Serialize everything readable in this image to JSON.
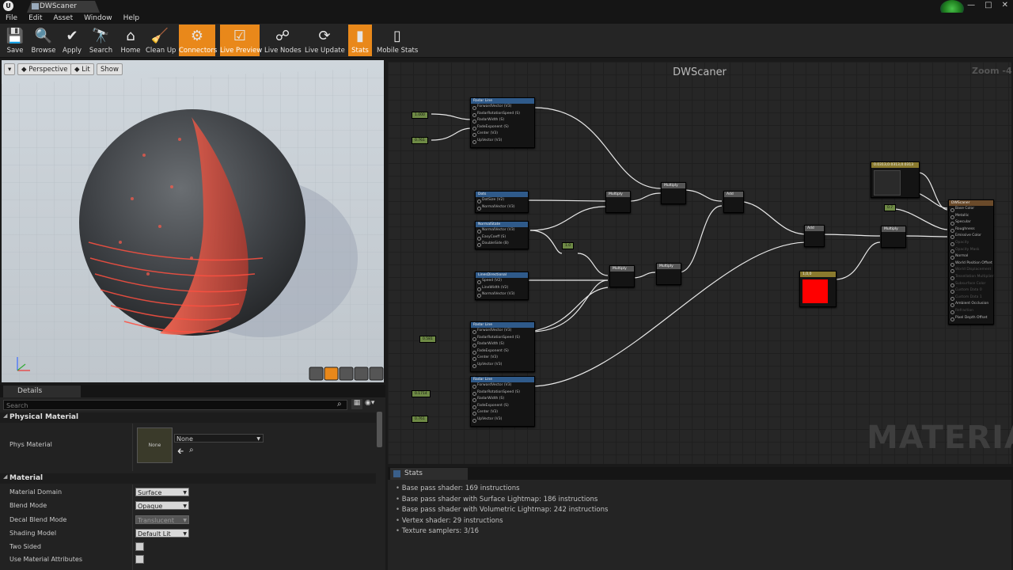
{
  "window": {
    "tab_title": "DWScaner",
    "controls": [
      "—",
      "□",
      "✕"
    ]
  },
  "menu": [
    "File",
    "Edit",
    "Asset",
    "Window",
    "Help"
  ],
  "toolbar": [
    {
      "label": "Save",
      "icon": "save-icon",
      "glyph": "💾",
      "active": false
    },
    {
      "label": "Browse",
      "icon": "browse-icon",
      "glyph": "🔍",
      "active": false
    },
    {
      "label": "Apply",
      "icon": "apply-icon",
      "glyph": "✔",
      "active": false
    },
    {
      "label": "Search",
      "icon": "search-icon",
      "glyph": "🔭",
      "active": false
    },
    {
      "label": "Home",
      "icon": "home-icon",
      "glyph": "⌂",
      "active": false
    },
    {
      "label": "Clean Up",
      "icon": "cleanup-icon",
      "glyph": "🧹",
      "active": false
    },
    {
      "label": "Connectors",
      "icon": "connectors-icon",
      "glyph": "⚙",
      "active": true
    },
    {
      "label": "Live Preview",
      "icon": "live-preview-icon",
      "glyph": "☑",
      "active": true
    },
    {
      "label": "Live Nodes",
      "icon": "live-nodes-icon",
      "glyph": "☍",
      "active": false
    },
    {
      "label": "Live Update",
      "icon": "live-update-icon",
      "glyph": "⟳",
      "active": false
    },
    {
      "label": "Stats",
      "icon": "stats-icon",
      "glyph": "▮",
      "active": true
    },
    {
      "label": "Mobile Stats",
      "icon": "mobile-stats-icon",
      "glyph": "▯",
      "active": false
    }
  ],
  "viewport": {
    "view_mode": "Perspective",
    "lighting": "Lit",
    "show": "Show"
  },
  "details": {
    "tab": "Details",
    "search_placeholder": "Search",
    "physical_material_header": "Physical Material",
    "phys_material_label": "Phys Material",
    "phys_material_thumb": "None",
    "phys_material_value": "None",
    "material_header": "Material",
    "props": [
      {
        "label": "Material Domain",
        "value": "Surface",
        "type": "dropdown"
      },
      {
        "label": "Blend Mode",
        "value": "Opaque",
        "type": "dropdown"
      },
      {
        "label": "Decal Blend Mode",
        "value": "Translucent",
        "type": "dropdown-disabled"
      },
      {
        "label": "Shading Model",
        "value": "Default Lit",
        "type": "dropdown"
      },
      {
        "label": "Two Sided",
        "value": "",
        "type": "checkbox"
      },
      {
        "label": "Use Material Attributes",
        "value": "",
        "type": "checkbox"
      }
    ]
  },
  "graph": {
    "title": "DWScaner",
    "zoom": "Zoom -4",
    "watermark": "MATERIAL",
    "constants": {
      "c1": "1.000",
      "c2": "0.761",
      "c3": "0.581",
      "c4": "0.1714",
      "c5": "0.761",
      "c6": "1.0",
      "c7": "0.7",
      "vec3": "0.0313,0.0313,0.0313",
      "vec4": "1,0,0"
    },
    "nodes": {
      "radar1": {
        "title": "Radar Line",
        "pins": [
          "ForwardVector (V3)",
          "RadarRotationSpeed (S)",
          "RadarWidth (S)",
          "FadeExponent (S)",
          "Center (V3)",
          "UpVector (V3)"
        ],
        "out": "Result"
      },
      "radar2": {
        "title": "Radar Line",
        "pins": [
          "ForwardVector (V3)",
          "RadarRotationSpeed (S)",
          "RadarWidth (S)",
          "FadeExponent (S)",
          "Center (V3)",
          "UpVector (V3)"
        ],
        "out": "Result"
      },
      "radar3": {
        "title": "Radar Line",
        "pins": [
          "ForwardVector (V3)",
          "RadarRotationSpeed (S)",
          "RadarWidth (S)",
          "FadeExponent (S)",
          "Center (V3)",
          "UpVector (V3)"
        ],
        "out": "Result"
      },
      "dots": {
        "title": "Dots",
        "pins": [
          "DotSize (V2)",
          "NormalVector (V3)"
        ],
        "out": "Result"
      },
      "normal": {
        "title": "NormalState",
        "pins": [
          "NormalVector (V3)",
          "EasyCoeff (S)",
          "DoubleSide (B)"
        ],
        "out": "Result"
      },
      "lines": {
        "title": "LinesDirectional",
        "pins": [
          "Speed (V2)",
          "LineWidth (V2)",
          "NormalVector (V3)"
        ],
        "out": "Result"
      },
      "mul1": {
        "title": "Multiply"
      },
      "mul2": {
        "title": "Multiply"
      },
      "mul3": {
        "title": "Multiply"
      },
      "mul4": {
        "title": "Multiply"
      },
      "mul5": {
        "title": "Multiply"
      },
      "add1": {
        "title": "Add"
      },
      "add2": {
        "title": "Add"
      },
      "result": {
        "title": "DWScaner",
        "pins": [
          "Base Color",
          "Metallic",
          "Specular",
          "Roughness",
          "Emissive Color",
          "Opacity",
          "Opacity Mask",
          "Normal",
          "World Position Offset",
          "World Displacement",
          "Tessellation Multiplier",
          "Subsurface Color",
          "Custom Data 0",
          "Custom Data 1",
          "Ambient Occlusion",
          "Refraction",
          "Pixel Depth Offset"
        ]
      }
    }
  },
  "stats": {
    "tab": "Stats",
    "lines": [
      "Base pass shader: 169 instructions",
      "Base pass shader with Surface Lightmap: 186 instructions",
      "Base pass shader with Volumetric Lightmap: 242 instructions",
      "Vertex shader: 29 instructions",
      "Texture samplers: 3/16"
    ]
  }
}
